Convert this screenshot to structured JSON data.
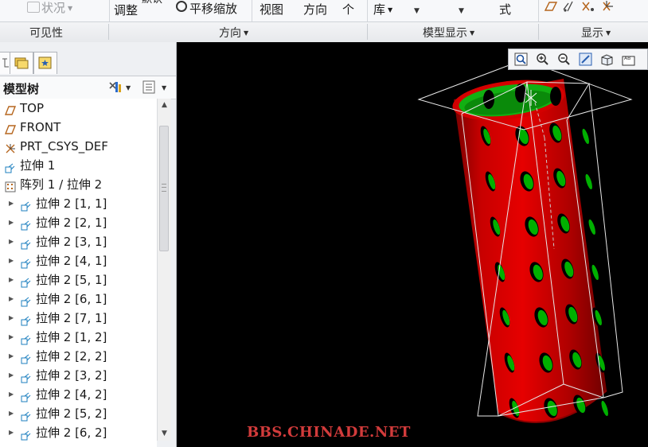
{
  "ribbon": {
    "state_label": "状况",
    "adjust_label": "调整",
    "partial_top_label": "默认",
    "pan_zoom_label": "平移缩放",
    "view_label": "视图",
    "direction_label": "方向",
    "single_label": "个",
    "library_label": "库",
    "style_label": "式"
  },
  "groups": {
    "visibility": "可见性",
    "orientation": "方向",
    "model_display": "模型显示",
    "display": "显示"
  },
  "panel": {
    "title": "模型树"
  },
  "tree": {
    "items": [
      {
        "label": "TOP",
        "icon": "datum-plane-icon"
      },
      {
        "label": "FRONT",
        "icon": "datum-plane-icon"
      },
      {
        "label": "PRT_CSYS_DEF",
        "icon": "coordinate-system-icon"
      },
      {
        "label": "拉伸 1",
        "icon": "extrude-icon"
      },
      {
        "label": "阵列 1 / 拉伸 2",
        "icon": "pattern-icon"
      },
      {
        "label": "拉伸 2 [1, 1]",
        "icon": "extrude-icon"
      },
      {
        "label": "拉伸 2 [2, 1]",
        "icon": "extrude-icon"
      },
      {
        "label": "拉伸 2 [3, 1]",
        "icon": "extrude-icon"
      },
      {
        "label": "拉伸 2 [4, 1]",
        "icon": "extrude-icon"
      },
      {
        "label": "拉伸 2 [5, 1]",
        "icon": "extrude-icon"
      },
      {
        "label": "拉伸 2 [6, 1]",
        "icon": "extrude-icon"
      },
      {
        "label": "拉伸 2 [7, 1]",
        "icon": "extrude-icon"
      },
      {
        "label": "拉伸 2 [1, 2]",
        "icon": "extrude-icon"
      },
      {
        "label": "拉伸 2 [2, 2]",
        "icon": "extrude-icon"
      },
      {
        "label": "拉伸 2 [3, 2]",
        "icon": "extrude-icon"
      },
      {
        "label": "拉伸 2 [4, 2]",
        "icon": "extrude-icon"
      },
      {
        "label": "拉伸 2 [5, 2]",
        "icon": "extrude-icon"
      },
      {
        "label": "拉伸 2 [6, 2]",
        "icon": "extrude-icon"
      }
    ]
  },
  "view_toolbar": {
    "icons": [
      "refit-icon",
      "zoom-in-icon",
      "zoom-out-icon",
      "repaint-icon",
      "display-style-icon",
      "annotation-display-icon"
    ]
  },
  "viewport": {
    "watermark": "BBS.CHINADE.NET"
  },
  "colors": {
    "model_red": "#cc0000",
    "hole_green": "#00b000",
    "background": "#000000",
    "watermark": "#d23b3b"
  }
}
